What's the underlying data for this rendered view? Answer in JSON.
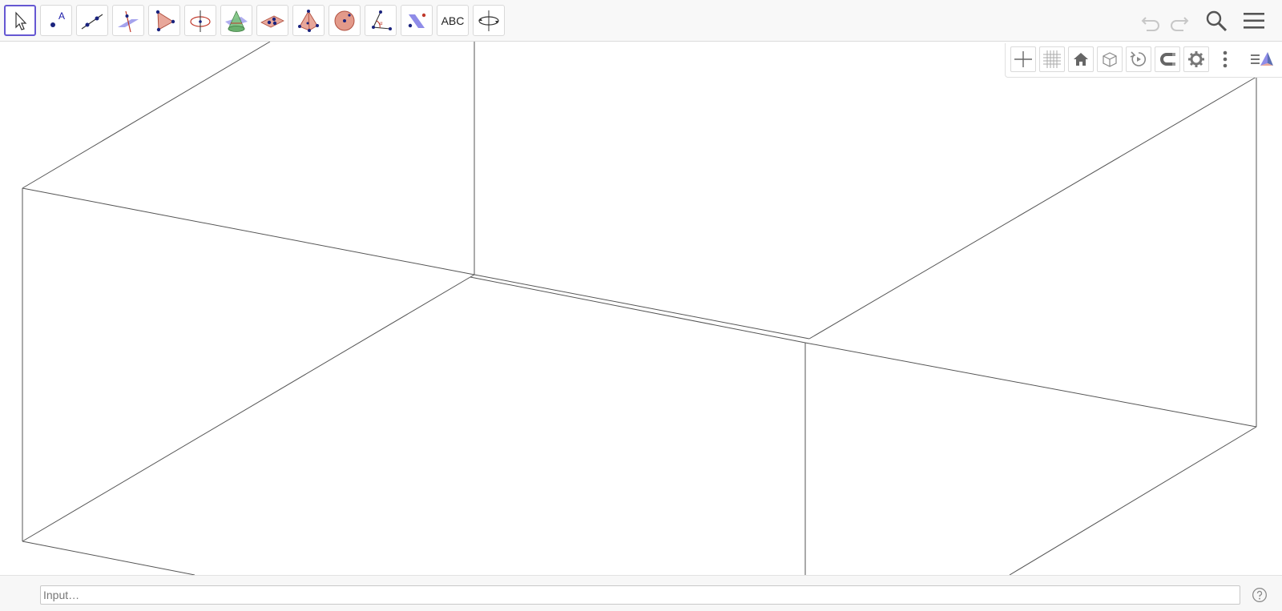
{
  "toolbar": {
    "tools": [
      {
        "name": "move-tool",
        "icon": "arrow-cursor-icon"
      },
      {
        "name": "point-tool",
        "icon": "point-icon",
        "label": "A"
      },
      {
        "name": "line-tool",
        "icon": "line-icon"
      },
      {
        "name": "perpendicular-line-tool",
        "icon": "perpendicular-icon"
      },
      {
        "name": "polygon-tool",
        "icon": "polygon-icon"
      },
      {
        "name": "circle-axis-point-tool",
        "icon": "circle-axis-icon"
      },
      {
        "name": "intersect-surfaces-tool",
        "icon": "cone-intersect-icon"
      },
      {
        "name": "plane-through-points-tool",
        "icon": "plane-points-icon"
      },
      {
        "name": "pyramid-tool",
        "icon": "pyramid-icon"
      },
      {
        "name": "sphere-tool",
        "icon": "sphere-icon"
      },
      {
        "name": "angle-tool",
        "icon": "angle-icon"
      },
      {
        "name": "reflect-tool",
        "icon": "reflect-icon"
      },
      {
        "name": "text-tool",
        "icon": "text-icon",
        "label": "ABC"
      },
      {
        "name": "rotate-view-tool",
        "icon": "rotate-view-icon"
      }
    ],
    "undo_icon": "undo-icon",
    "redo_icon": "redo-icon",
    "search_icon": "search-icon",
    "menu_icon": "hamburger-menu-icon"
  },
  "stylebar": {
    "buttons": [
      "axes-icon",
      "grid-icon",
      "home-icon",
      "cube-view-icon",
      "rotate-icon",
      "magnet-icon",
      "gear-icon",
      "more-icon",
      "perspectives-icon"
    ]
  },
  "input": {
    "placeholder": "Input…",
    "value": "",
    "help_icon": "help-icon"
  },
  "colors": {
    "accent": "#6557d2",
    "toolbar_bg": "#f8f8f8",
    "point": "#1a237e",
    "polygon_fill": "#e8a79a",
    "plane_fill": "#8f8ce8"
  }
}
